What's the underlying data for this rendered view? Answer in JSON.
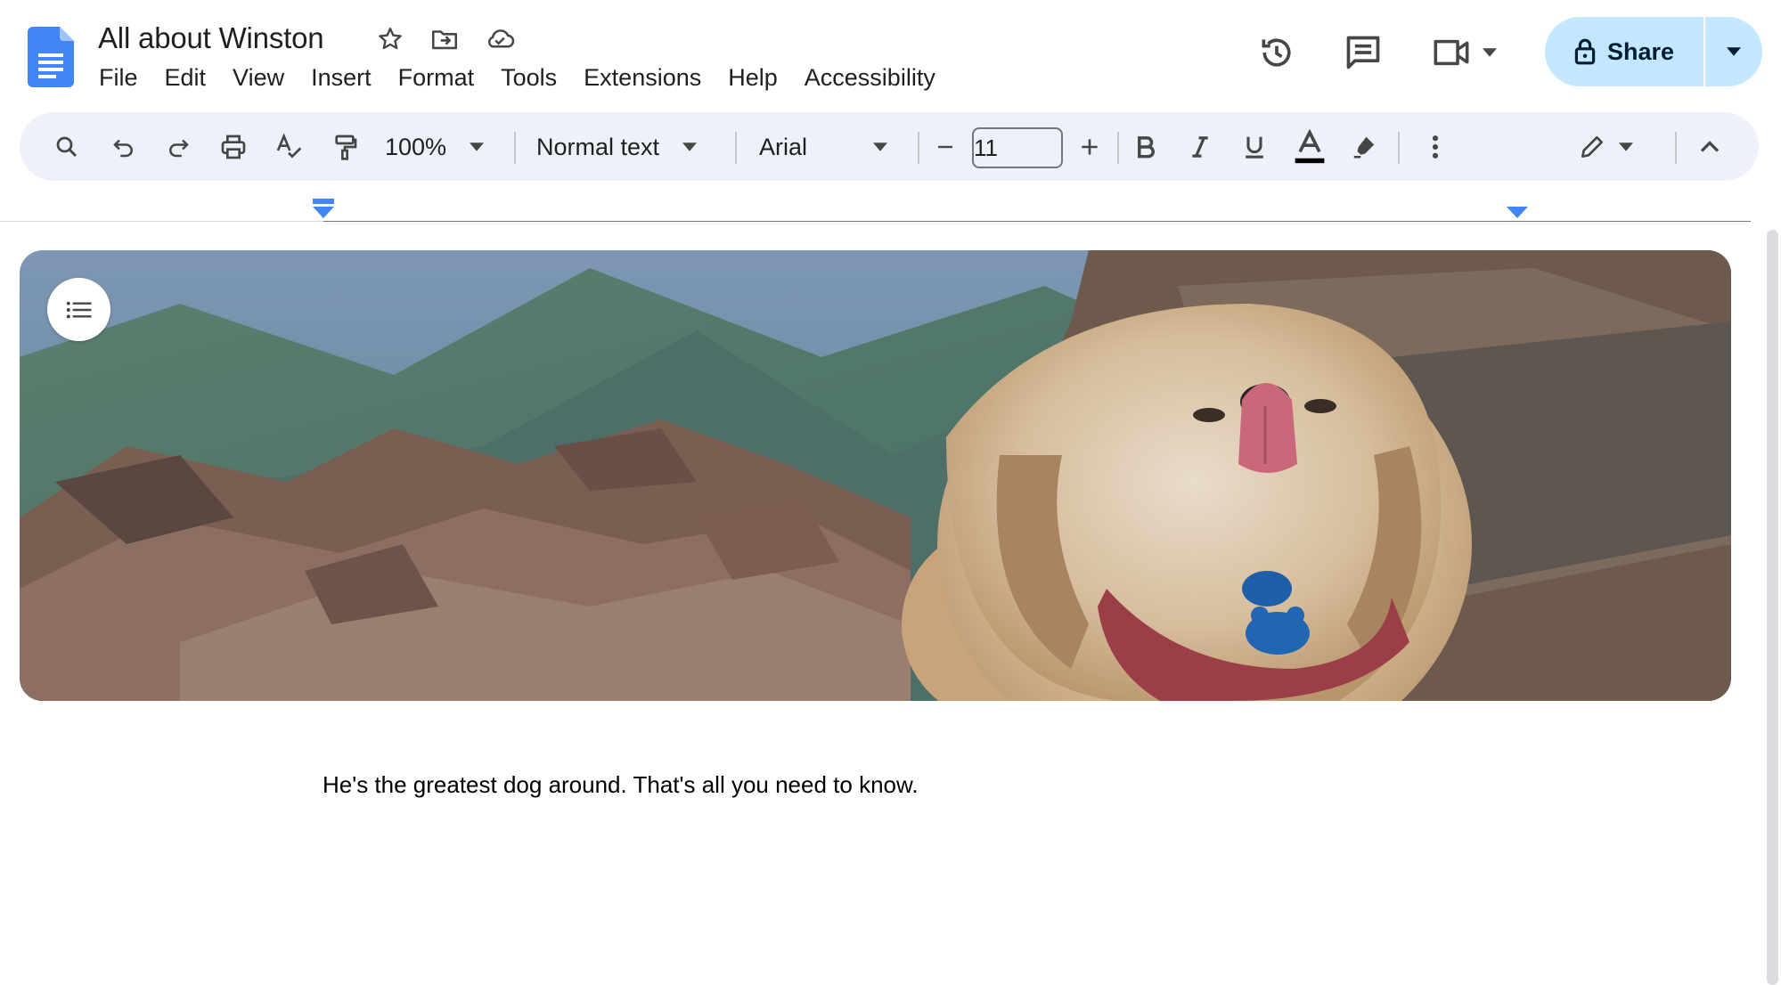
{
  "document": {
    "title": "All about Winston",
    "body_text": "He's the greatest dog around. That's all you need to know."
  },
  "menu": {
    "items": [
      "File",
      "Edit",
      "View",
      "Insert",
      "Format",
      "Tools",
      "Extensions",
      "Help",
      "Accessibility"
    ]
  },
  "header": {
    "share_label": "Share",
    "icons": [
      "star-icon",
      "move-to-folder-icon",
      "cloud-saved-icon",
      "version-history-icon",
      "comments-icon",
      "meet-icon",
      "lock-icon"
    ]
  },
  "toolbar": {
    "zoom": "100%",
    "style": "Normal text",
    "font": "Arial",
    "font_size": "11",
    "icons": [
      "search-icon",
      "undo-icon",
      "redo-icon",
      "print-icon",
      "spellcheck-icon",
      "paint-format-icon",
      "decrease-font-icon",
      "increase-font-icon",
      "bold-icon",
      "italic-icon",
      "underline-icon",
      "text-color-icon",
      "highlight-icon",
      "more-options-icon",
      "editing-mode-icon",
      "collapse-icon"
    ]
  },
  "colors": {
    "brand_blue": "#4285f4",
    "share_bg": "#c2e7ff",
    "toolbar_bg": "#edf2fa",
    "ruler_marker": "#4285f4"
  }
}
